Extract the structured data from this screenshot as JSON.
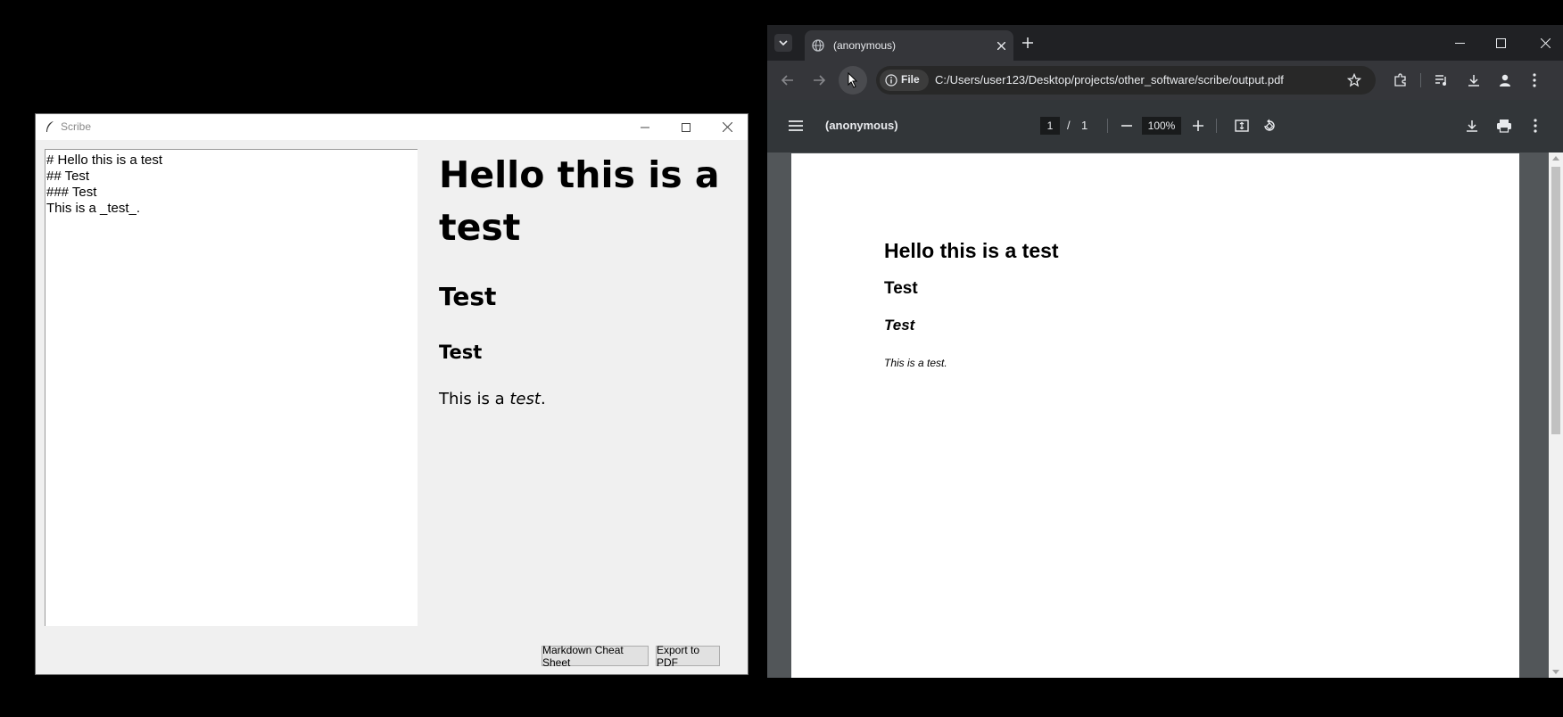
{
  "scribe": {
    "window_title": "Scribe",
    "editor_lines": [
      "# Hello this is a test",
      "## Test",
      "### Test",
      "This is a _test_."
    ],
    "preview": {
      "h1": "Hello this is a test",
      "h2": "Test",
      "h3": "Test",
      "para_prefix": "This is a ",
      "para_emphasis": "test",
      "para_suffix": "."
    },
    "buttons": {
      "cheat_sheet": "Markdown Cheat Sheet",
      "export": "Export to PDF"
    }
  },
  "browser": {
    "tab_title": "(anonymous)",
    "address_scheme": "File",
    "url": "C:/Users/user123/Desktop/projects/other_software/scribe/output.pdf",
    "viewer": {
      "doc_title": "(anonymous)",
      "page_current": "1",
      "page_separator": "/",
      "page_total": "1",
      "zoom": "100%"
    },
    "pdf": {
      "h1": "Hello this is a test",
      "h2": "Test",
      "h3": "Test",
      "para": "This is a test."
    }
  },
  "colors": {
    "desktop": "#000000",
    "chrome_dark": "#202124",
    "chrome_toolbar": "#35363a",
    "pdf_viewer_bar": "#323639",
    "pdf_background": "#525659"
  }
}
